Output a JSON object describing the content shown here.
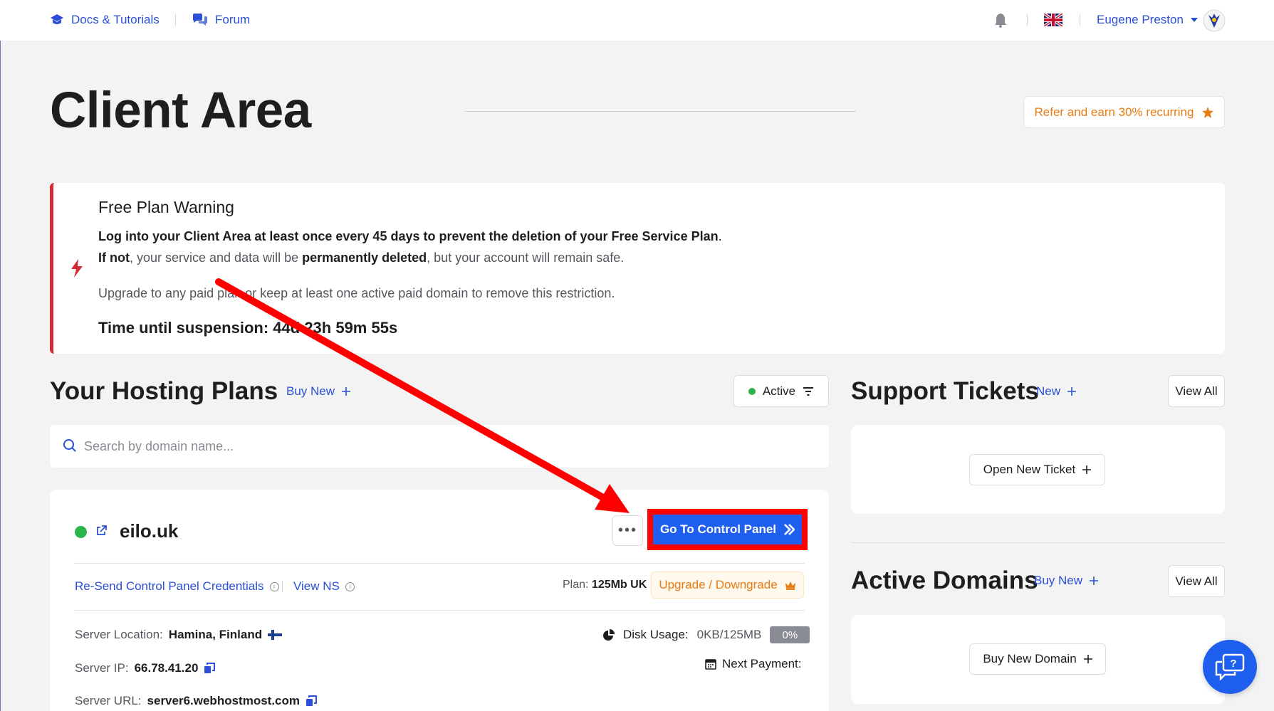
{
  "topbar": {
    "docs_label": "Docs & Tutorials",
    "forum_label": "Forum",
    "user_name": "Eugene Preston"
  },
  "header": {
    "title": "Client Area",
    "refer_label": "Refer and earn 30% recurring"
  },
  "warning": {
    "title": "Free Plan Warning",
    "line1": "Log into your Client Area at least once every 45 days to prevent the deletion of your Free Service Plan",
    "line1_end": ".",
    "line2_a": "If not",
    "line2_b": ", your service and data will be ",
    "line2_c": "permanently deleted",
    "line2_d": ", but your account will remain safe.",
    "line3": "Upgrade to any paid plan or keep at least one active paid domain to remove this restriction.",
    "countdown_label": "Time until suspension: ",
    "countdown_value": "44d 23h 59m 55s"
  },
  "hosting": {
    "title": "Your Hosting Plans",
    "buy_new_label": "Buy New",
    "filter_label": "Active",
    "search_placeholder": "Search by domain name...",
    "plan": {
      "domain": "eilo.uk",
      "control_panel_label": "Go To Control Panel",
      "resend_label": "Re-Send Control Panel Credentials",
      "view_ns_label": "View NS",
      "plan_label": "Plan:",
      "plan_value": "125Mb UK",
      "upgrade_label": "Upgrade / Downgrade",
      "server_location_label": "Server Location:",
      "server_location_value": "Hamina, Finland",
      "server_ip_label": "Server IP:",
      "server_ip_value": "66.78.41.20",
      "server_url_label": "Server URL:",
      "server_url_value": "server6.webhostmost.com",
      "disk_usage_label": "Disk Usage:",
      "disk_usage_value": "0KB/125MB",
      "disk_usage_percent": "0%",
      "next_payment_label": "Next Payment:"
    }
  },
  "tickets": {
    "title": "Support Tickets",
    "new_label": "New",
    "view_all_label": "View All",
    "open_ticket_label": "Open New Ticket"
  },
  "domains": {
    "title": "Active Domains",
    "buy_new_label": "Buy New",
    "view_all_label": "View All",
    "buy_domain_label": "Buy New Domain"
  },
  "colors": {
    "accent": "#2b4fd6",
    "primary_button": "#1f5ff0",
    "warning_border": "#d42a35",
    "highlight_red": "#ff0000",
    "orange": "#e77b14",
    "status_green": "#2bb44a"
  }
}
